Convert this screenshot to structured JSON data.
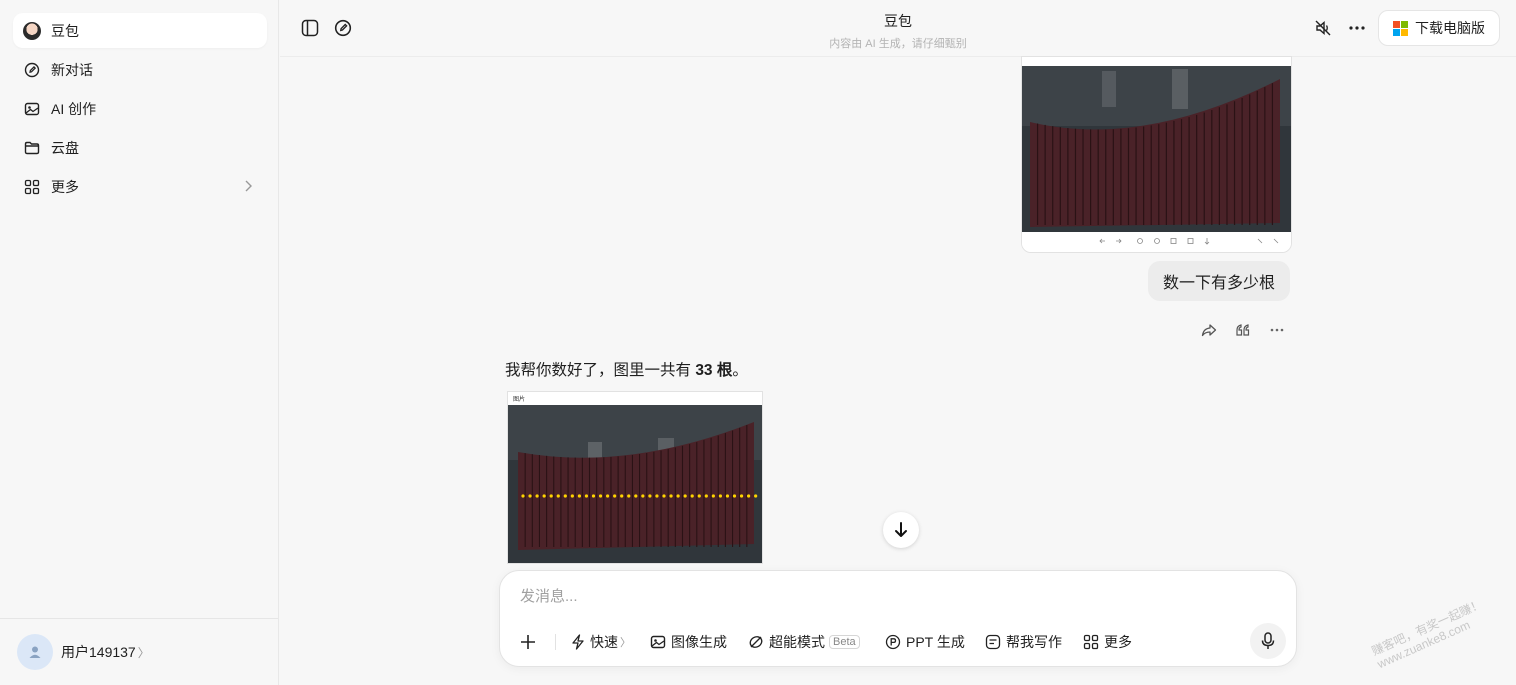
{
  "sidebar": {
    "items": [
      {
        "label": "豆包",
        "icon": "doubao-avatar-icon"
      },
      {
        "label": "新对话",
        "icon": "edit-icon"
      },
      {
        "label": "AI 创作",
        "icon": "image-icon"
      },
      {
        "label": "云盘",
        "icon": "folder-icon"
      },
      {
        "label": "更多",
        "icon": "grid-icon"
      }
    ],
    "user": {
      "name": "用户149137",
      "arrow": "〉"
    }
  },
  "header": {
    "title": "豆包",
    "subtitle": "内容由 AI 生成，请仔细甄别",
    "download_label": "下载电脑版"
  },
  "conversation": {
    "user_message": "数一下有多少根",
    "answer_prefix": "我帮你数好了，图里一共有 ",
    "answer_count": "33 根",
    "answer_suffix": "。"
  },
  "composer": {
    "placeholder": "发消息...",
    "tools": {
      "fast": "快速",
      "fast_arrow": "〉",
      "image_gen": "图像生成",
      "super": "超能模式",
      "beta": "Beta",
      "ppt": "PPT 生成",
      "write": "帮我写作",
      "more": "更多"
    }
  },
  "watermark": {
    "line1": "赚客吧，有奖一起赚！",
    "line2": "www.zuanke8.com"
  },
  "colors": {
    "accent": "#1f1f1f",
    "bar": "#4a2228",
    "dots": "#ffd400"
  }
}
